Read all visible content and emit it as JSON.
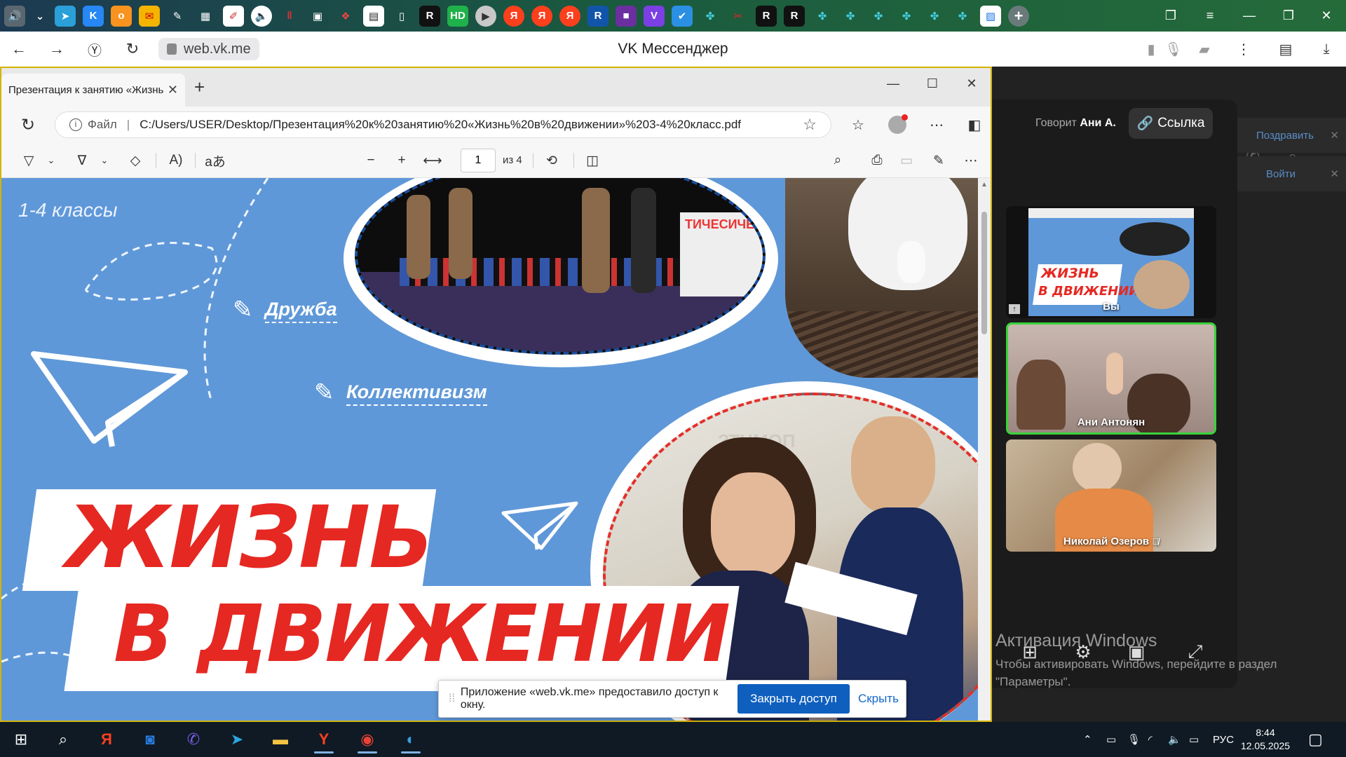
{
  "outer_browser": {
    "url": "web.vk.me",
    "page_title": "VK Мессенджер",
    "tab_icons": [
      "sound-icon",
      "telegram-icon",
      "vk-icon",
      "ok-icon",
      "mail-icon",
      "pen-icon",
      "app-icon",
      "drawing-icon",
      "speaker-icon",
      "audio-icon",
      "image-icon",
      "translate-icon",
      "doc-icon",
      "r-icon",
      "hd-icon",
      "play-icon",
      "yandex-icon",
      "yandex-icon",
      "yandex-icon",
      "r-icon",
      "square-icon",
      "viber-icon",
      "check-icon",
      "figma-icon",
      "scissors-icon",
      "r-icon",
      "r-icon",
      "figma-icon",
      "figma-icon",
      "figma-icon",
      "figma-icon",
      "figma-icon",
      "figma-icon",
      "docs-icon"
    ],
    "new_tab": "+"
  },
  "edge": {
    "tab_title": "Презентация к занятию «Жизнь",
    "address_prefix": "Файл",
    "address_url": "C:/Users/USER/Desktop/Презентация%20к%20занятию%20«Жизнь%20в%20движении»%203-4%20класс.pdf",
    "page_current": "1",
    "page_of": "из 4"
  },
  "slide": {
    "grade": "1-4 классы",
    "tag1": "Дружба",
    "tag2": "Коллективизм",
    "line1": "ЖИЗНЬ",
    "line2": "В ДВИЖЕНИИ",
    "photo_text": "ТИЧЕСИЧЕ",
    "photo_text2": "ЗТНМОП"
  },
  "share_bar": {
    "text": "Приложение «web.vk.me» предоставило доступ к окну.",
    "close_label": "Закрыть доступ",
    "hide_label": "Скрыть"
  },
  "vk": {
    "speaking_prefix": "Говорит",
    "speaking_name": "Ани А.",
    "link_label": "Ссылка",
    "bg_row1": "Поздравить",
    "bg_row2": "Войти",
    "tiles": [
      {
        "name": "Вы",
        "preview_line1": "ЖИЗНЬ",
        "preview_line2": "В ДВИЖЕНИИ"
      },
      {
        "name": "Ани Антонян"
      },
      {
        "name": "Николай Озеров"
      }
    ]
  },
  "watermark": {
    "title": "Активация Windows",
    "line1": "Чтобы активировать Windows, перейдите в раздел",
    "line2": "\"Параметры\"."
  },
  "taskbar": {
    "lang": "РУС",
    "time": "8:44",
    "date": "12.05.2025"
  },
  "colors": {
    "slide_blue": "#5f98d8",
    "slide_red": "#e62822",
    "call_active_border": "#3ad33a",
    "share_button": "#0f5fbf"
  }
}
